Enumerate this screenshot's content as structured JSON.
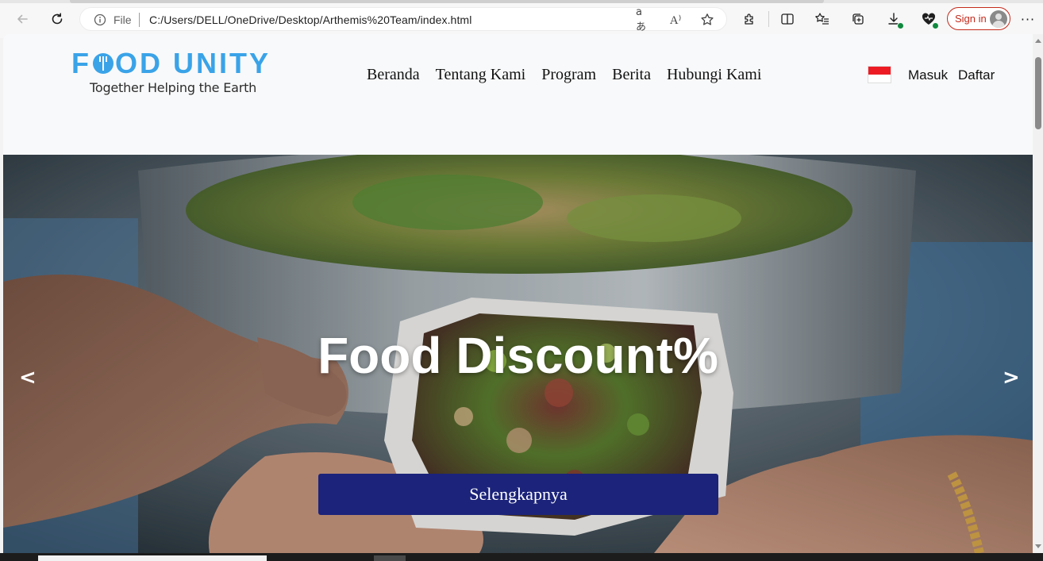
{
  "browser": {
    "address_bar": {
      "scheme_label": "File",
      "url": "C:/Users/DELL/OneDrive/Desktop/Arthemis%20Team/index.html",
      "readaloud_glyph": "aあ",
      "immersive_glyph": "A⁾"
    },
    "signin_label": "Sign in",
    "more_glyph": "···"
  },
  "site": {
    "logo": {
      "word_part1": "F",
      "word_part2": "OD UNITY",
      "tagline": "Together Helping the Earth",
      "color": "#3aa3e8"
    },
    "nav": [
      "Beranda",
      "Tentang Kami",
      "Program",
      "Berita",
      "Hubungi Kami"
    ],
    "auth": {
      "login": "Masuk",
      "register": "Daftar"
    },
    "flag": {
      "top_color": "#ed1c24",
      "bottom_color": "#ffffff"
    }
  },
  "hero": {
    "title": "Food Discount%",
    "prev": "<",
    "next": ">",
    "cta_label": "Selengkapnya",
    "cta_color": "#1b237a"
  }
}
